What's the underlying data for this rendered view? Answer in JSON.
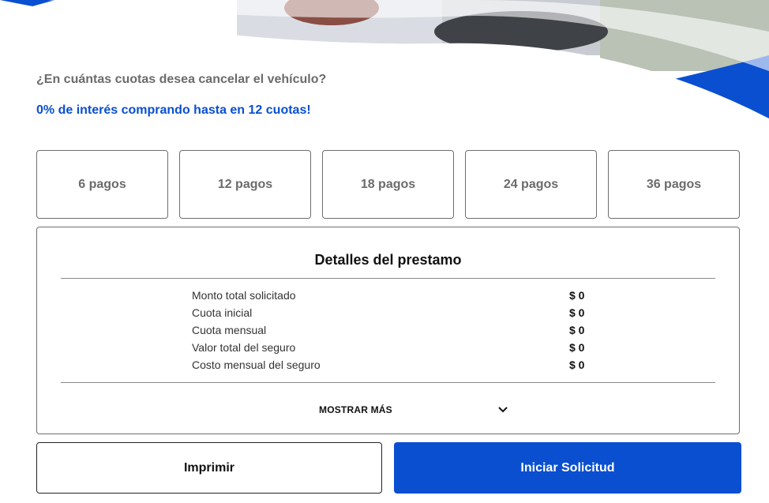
{
  "header": {
    "question": "¿En cuántas cuotas desea cancelar el vehículo?",
    "promo": "0% de interés comprando hasta en 12 cuotas!"
  },
  "plans": [
    {
      "label": "6 pagos"
    },
    {
      "label": "12 pagos"
    },
    {
      "label": "18 pagos"
    },
    {
      "label": "24 pagos"
    },
    {
      "label": "36 pagos"
    }
  ],
  "details": {
    "title": "Detalles del prestamo",
    "rows": [
      {
        "label": "Monto total solicitado",
        "value": "$ 0"
      },
      {
        "label": "Cuota inicial",
        "value": "$ 0"
      },
      {
        "label": "Cuota mensual",
        "value": "$ 0"
      },
      {
        "label": "Valor total del seguro",
        "value": "$ 0"
      },
      {
        "label": "Costo mensual del seguro",
        "value": "$ 0"
      }
    ],
    "show_more_label": "MOSTRAR MÁS",
    "show_more_icon": "chevron-down-icon"
  },
  "actions": {
    "print_label": "Imprimir",
    "start_label": "Iniciar Solicitud"
  },
  "colors": {
    "accent": "#0a4fd0",
    "muted_text": "#6b6b6b",
    "border": "#6e6e6e"
  }
}
